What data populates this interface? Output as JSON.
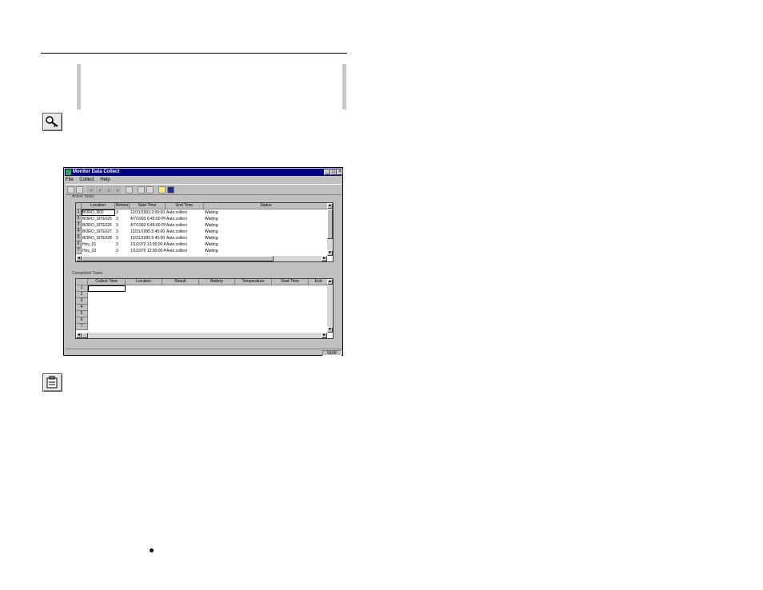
{
  "window": {
    "title": "Monitor Data Collect",
    "minimize": "_",
    "maximize": "□",
    "close": "×"
  },
  "menu": [
    "File",
    "Collect",
    "Help"
  ],
  "toolbar": {
    "icons": [
      "new-icon",
      "print-icon",
      "record-icon",
      "record-icon",
      "record-icon",
      "record-icon",
      "open-icon",
      "collect-icon",
      "collect-icon",
      "schedule-icon",
      "help-icon"
    ]
  },
  "active_tasks": {
    "label": "Active Tasks",
    "columns": [
      "Location",
      "Retries",
      "Start Time",
      "End Time",
      "Status"
    ],
    "rows": [
      {
        "n": "1",
        "location": "BORO_R02",
        "retries": "3",
        "start": "12/31/1993 2:05:00",
        "end": "Auto collect",
        "status": "Waiting"
      },
      {
        "n": "2",
        "location": "BORO_SITE025",
        "retries": "3",
        "start": "4/7/1993 6:45:00 PM",
        "end": "Auto collect",
        "status": "Waiting"
      },
      {
        "n": "3",
        "location": "BORO_SITE026",
        "retries": "3",
        "start": "4/7/1993 6:45:00 PM",
        "end": "Auto collect",
        "status": "Waiting"
      },
      {
        "n": "4",
        "location": "BORO_SITE027",
        "retries": "3",
        "start": "12/31/1995 5:45:00",
        "end": "Auto collect",
        "status": "Waiting"
      },
      {
        "n": "5",
        "location": "BORO_SITE028",
        "retries": "3",
        "start": "12/31/1995 5:45:00",
        "end": "Auto collect",
        "status": "Waiting"
      },
      {
        "n": "6",
        "location": "Hov_01",
        "retries": "3",
        "start": "1/1/1970 12:00:00 A",
        "end": "Auto collect",
        "status": "Waiting"
      },
      {
        "n": "7",
        "location": "Hov_02",
        "retries": "3",
        "start": "1/1/1970 12:00:00 A",
        "end": "Auto collect",
        "status": "Waiting"
      }
    ]
  },
  "completed_tasks": {
    "label": "Completed Tasks",
    "columns": [
      "Collect Time",
      "Location",
      "Result",
      "Battery",
      "Temperature",
      "Start Time",
      "End"
    ],
    "row_numbers": [
      "1",
      "2",
      "3",
      "4",
      "5",
      "6",
      "7"
    ]
  },
  "status_bar": {
    "indicator": "NUM"
  },
  "scroll": {
    "up": "▲",
    "down": "▼",
    "left": "◄",
    "right": "►"
  }
}
